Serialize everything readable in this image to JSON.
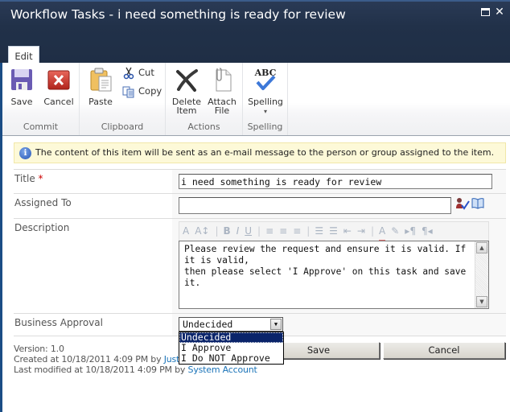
{
  "window": {
    "title": "Workflow Tasks - i need something is ready for review",
    "maximize_icon": "maximize-icon",
    "close_icon": "close-icon",
    "close_glyph": "✕"
  },
  "ribbon": {
    "tabs": [
      {
        "label": "Edit",
        "active": true
      }
    ],
    "groups": [
      {
        "label": "Commit",
        "buttons": [
          {
            "label": "Save",
            "icon": "floppy-disk-icon"
          },
          {
            "label": "Cancel",
            "icon": "red-x-icon"
          }
        ]
      },
      {
        "label": "Clipboard",
        "buttons": [
          {
            "label": "Paste",
            "icon": "clipboard-icon"
          },
          {
            "label": "Cut",
            "icon": "scissors-icon"
          },
          {
            "label": "Copy",
            "icon": "copy-icon"
          }
        ]
      },
      {
        "label": "Actions",
        "buttons": [
          {
            "label_line1": "Delete",
            "label_line2": "Item",
            "icon": "delete-x-icon"
          },
          {
            "label_line1": "Attach",
            "label_line2": "File",
            "icon": "paperclip-document-icon"
          }
        ]
      },
      {
        "label": "Spelling",
        "buttons": [
          {
            "label": "Spelling",
            "icon": "abc-check-icon",
            "dropdown_glyph": "▾"
          }
        ]
      }
    ]
  },
  "info": {
    "icon": "info-icon",
    "glyph": "i",
    "message": "The content of this item will be sent as an e-mail message to the person or group assigned to the item."
  },
  "form": {
    "title": {
      "label": "Title",
      "required_marker": "*",
      "value": "i need something is ready for review"
    },
    "assigned_to": {
      "label": "Assigned To",
      "value": "",
      "check_names_icon": "check-names-icon",
      "browse_icon": "address-book-icon"
    },
    "description": {
      "label": "Description",
      "toolbar": [
        "A",
        "A↕",
        "|",
        "B",
        "I",
        "U",
        "|",
        "≡",
        "≡",
        "≡",
        "|",
        "☰",
        "☰",
        "⇤",
        "⇥",
        "|",
        "A",
        "✎",
        "▸¶",
        "¶◂"
      ],
      "toolbar_names": [
        "font-icon",
        "font-size-icon",
        "sep",
        "bold-icon",
        "italic-icon",
        "underline-icon",
        "sep",
        "align-left-icon",
        "align-center-icon",
        "align-right-icon",
        "sep",
        "numbered-list-icon",
        "bulleted-list-icon",
        "decrease-indent-icon",
        "increase-indent-icon",
        "sep",
        "text-color-icon",
        "highlight-icon",
        "ltr-icon",
        "rtl-icon"
      ],
      "value_line1": "Please review the request and ensure it is valid. If it is valid,",
      "value_line2": "then please select 'I Approve' on this task and save it."
    },
    "business_approval": {
      "label": "Business Approval",
      "selected": "Undecided",
      "options": [
        "Undecided",
        "I Approve",
        "I Do NOT Approve"
      ],
      "dropdown_open": true
    }
  },
  "footer": {
    "version": "Version: 1.0",
    "created_prefix": "Created at 10/18/2011 4:09 PM by ",
    "created_by": "Justin M",
    "modified_prefix": "Last modified at 10/18/2011 4:09 PM by ",
    "modified_by": "System Account",
    "save_label": "Save",
    "cancel_label": "Cancel"
  }
}
